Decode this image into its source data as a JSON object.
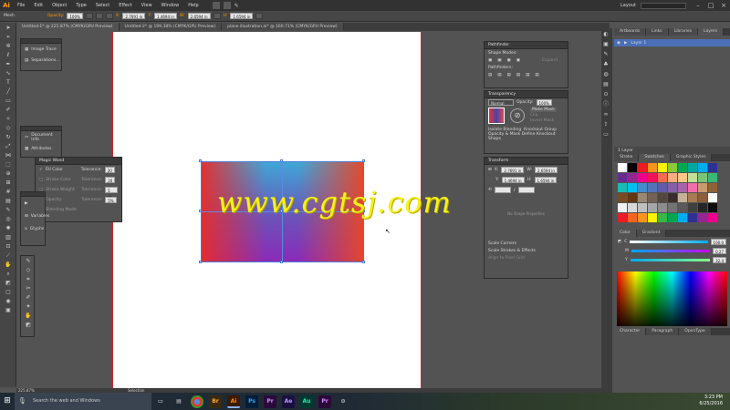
{
  "app": {
    "logo": "Ai",
    "workspace": "Layout",
    "search_placeholder": ""
  },
  "menu": [
    "File",
    "Edit",
    "Object",
    "Type",
    "Select",
    "Effect",
    "View",
    "Window",
    "Help"
  ],
  "control_bar": {
    "tool_name": "Mesh",
    "opacity_label": "Opacity:",
    "opacity_value": "100%",
    "x_value": "2.7691 in",
    "y_value": "1.4694 in",
    "w_value": "2.6594 in",
    "h_value": "1.6594 in",
    "x_label": "X:",
    "y_label": "Y:",
    "w_label": "W:",
    "h_label": "H:"
  },
  "doc_tabs": [
    "Untitled-1* @ 225.87% (CMYK/GPU Preview)",
    "Untitled-2* @ 199.38% (CMYK/GPU Preview)",
    "plane illustration.ai* @ 160.71% (CMYK/GPU Preview)"
  ],
  "panels": {
    "image_trace": {
      "items": [
        "Image Trace",
        "Separations..."
      ]
    },
    "doc_info": {
      "items": [
        "Document Info",
        "Attributes"
      ]
    },
    "magic_wand": {
      "title": "Magic Wand",
      "rows": [
        {
          "label": "Fill Color",
          "tol": "Tolerance:",
          "val": "20",
          "checked": true
        },
        {
          "label": "Stroke Color",
          "tol": "Tolerance:",
          "val": "20",
          "checked": false
        },
        {
          "label": "Stroke Weight",
          "tol": "Tolerance:",
          "val": "5 pt",
          "checked": false
        },
        {
          "label": "Opacity",
          "tol": "Tolerance:",
          "val": "5%",
          "checked": false
        },
        {
          "label": "Blending Mode",
          "tol": "",
          "val": "",
          "checked": false
        }
      ]
    },
    "variables": {
      "items": [
        "Variables",
        "Glyphs"
      ]
    },
    "pathfinder": {
      "title": "Pathfinder",
      "shape_modes": "Shape Modes:",
      "pathfinders": "Pathfinders:",
      "expand": "Expand"
    },
    "transparency": {
      "title": "Transparency",
      "mode": "Normal",
      "opacity_label": "Opacity:",
      "opacity": "100%",
      "make_mask": "Make Mask",
      "clip": "Clip",
      "invert": "Invert Mask",
      "isolate": "Isolate Blending",
      "knockout": "Knockout Group",
      "define": "Opacity & Mask Define Knockout Shape"
    },
    "transform": {
      "title": "Transform",
      "x": "2.7691 in",
      "y": "1.4694 in",
      "w": "2.6594 in",
      "h": "1.6594 in",
      "x_label": "X:",
      "y_label": "Y:",
      "w_label": "W:",
      "h_label": "H:",
      "no_shape": "No Shape Properties",
      "scale_corners": "Scale Corners",
      "scale_strokes": "Scale Strokes & Effects",
      "align_pixel": "Align to Pixel Grid"
    },
    "layers": {
      "tabs": [
        "Artboards",
        "Links",
        "Libraries",
        "Layers"
      ],
      "layer": "Layer 1",
      "footer": "1 Layer"
    },
    "swatches": {
      "tabs": [
        "Stroke",
        "Swatches",
        "Graphic Styles"
      ]
    },
    "color": {
      "tabs": [
        "Color",
        "Gradient"
      ],
      "c": "100.0",
      "m": "0.27",
      "y": "32.4",
      "c_label": "C",
      "m_label": "M",
      "y_label": "Y"
    },
    "character": {
      "tabs": [
        "Character",
        "Paragraph",
        "OpenType"
      ]
    }
  },
  "watermark": "www.cgtsj.com",
  "status": {
    "zoom": "225.87%",
    "tool": "Selection"
  },
  "taskbar": {
    "search": "Search the web and Windows",
    "time": "3:23 PM",
    "date": "6/25/2016",
    "apps": [
      "Br",
      "Ai",
      "Ps",
      "Pr",
      "Ae",
      "Au",
      "Pr"
    ]
  },
  "colors": {
    "accent": "#ff9a00",
    "artboard_line": "#d3262a",
    "watermark": "#f5f218"
  }
}
